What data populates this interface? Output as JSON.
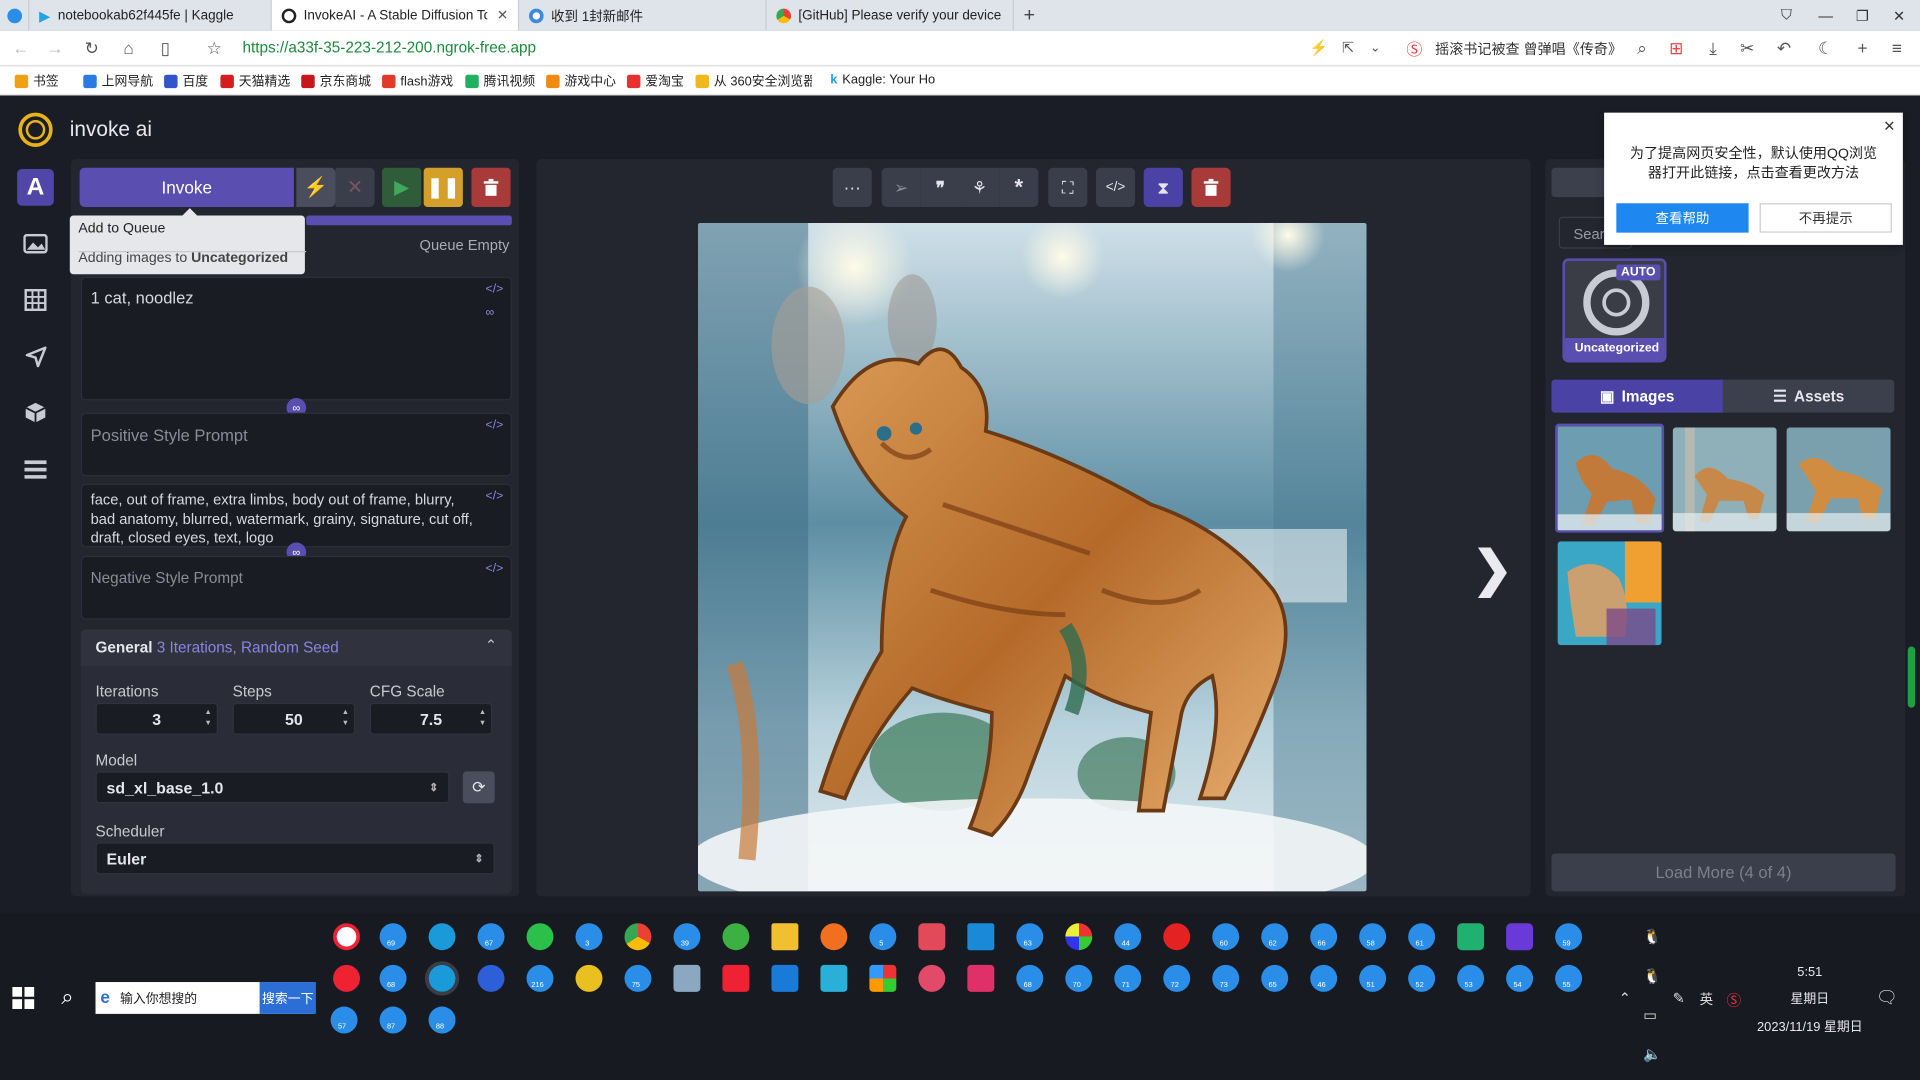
{
  "browser": {
    "tabs": [
      {
        "title": "notebookab62f445fe | Kaggle"
      },
      {
        "title": "InvokeAI - A Stable Diffusion Too"
      },
      {
        "title": "收到 1封新邮件"
      },
      {
        "title": "[GitHub] Please verify your device"
      }
    ],
    "url": "https://a33f-35-223-212-200.ngrok-free.app",
    "search_suggestion": "摇滚书记被查 曾弹唱《传奇》",
    "bookmarks": [
      "书签",
      "上网导航",
      "百度",
      "天猫精选",
      "京东商城",
      "flash游戏",
      "腾讯视频",
      "游戏中心",
      "爱淘宝",
      "从 360安全浏览器",
      "Kaggle: Your Ho"
    ]
  },
  "app": {
    "logo_text": "invoke ai",
    "sidenav": [
      "text-to-image-icon",
      "image-to-image-icon",
      "unified-canvas-icon",
      "nodes-icon",
      "model-manager-icon",
      "queue-icon"
    ],
    "invoke_label": "Invoke",
    "queue_status": "Queue Empty",
    "tooltip": {
      "title": "Add to Queue",
      "line_prefix": "Adding images to ",
      "line_board": "Uncategorized"
    },
    "positive_prompt": "1 cat, noodlez",
    "positive_style_placeholder": "Positive Style Prompt",
    "negative_prompt_visible": "face, out of frame, extra limbs, body out of frame, blurry, bad anatomy, blurred, watermark, grainy, signature, cut off, draft, closed eyes, text, logo",
    "negative_style_placeholder": "Negative Style Prompt",
    "general": {
      "title": "General",
      "summary": "3 Iterations, Random Seed",
      "iterations_label": "Iterations",
      "iterations": "3",
      "steps_label": "Steps",
      "steps": "50",
      "cfg_label": "CFG Scale",
      "cfg": "7.5",
      "model_label": "Model",
      "model": "sd_xl_base_1.0",
      "scheduler_label": "Scheduler",
      "scheduler": "Euler"
    },
    "gallery": {
      "search_placeholder": "Sear",
      "board_badge": "AUTO",
      "board_name": "Uncategorized",
      "tab_images": "Images",
      "tab_assets": "Assets",
      "load_more": "Load More (4 of 4)"
    }
  },
  "popup": {
    "message": "为了提高网页安全性，默认使用QQ浏览器打开此链接，点击查看更改方法",
    "help_button": "查看帮助",
    "dismiss_button": "不再提示"
  },
  "taskbar": {
    "search_placeholder": "输入你想搜的",
    "search_button": "搜索一下",
    "time": "5:51",
    "weekday": "星期日",
    "date": "2023/11/19 星期日",
    "ime": "英",
    "badges": [
      "69",
      "67",
      "3",
      "39",
      "5",
      "63",
      "44",
      "60",
      "62",
      "66",
      "58",
      "61",
      "59",
      "68",
      "216",
      "75",
      "68",
      "70",
      "71",
      "72",
      "73",
      "65",
      "46",
      "51",
      "52",
      "53",
      "54",
      "55",
      "57",
      "87",
      "88"
    ]
  },
  "colors": {
    "accent": "#5a4fb0",
    "panel": "#23252f",
    "background": "#1b1d26",
    "danger": "#a83a3a",
    "play": "#3f8f4a",
    "pause": "#d4a02a"
  }
}
